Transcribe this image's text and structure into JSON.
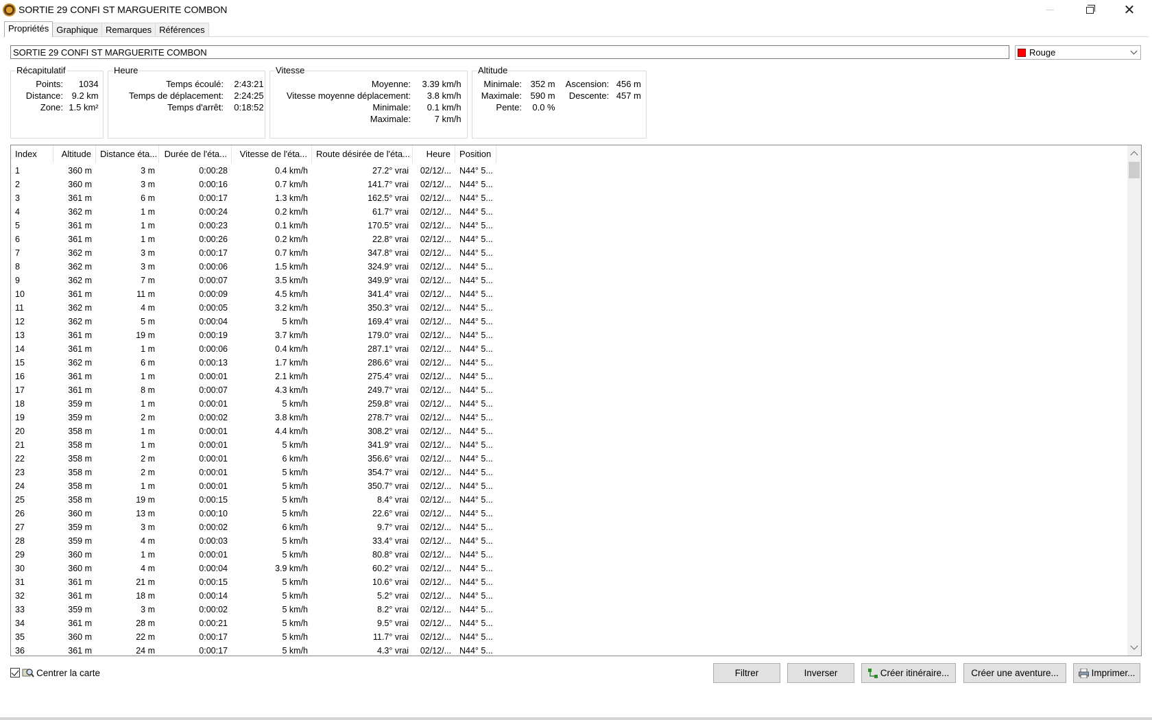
{
  "window": {
    "title": "SORTIE 29 CONFI ST MARGUERITE COMBON"
  },
  "tabs": [
    {
      "label": "Propriétés"
    },
    {
      "label": "Graphique"
    },
    {
      "label": "Remarques"
    },
    {
      "label": "Références"
    }
  ],
  "track": {
    "name": "SORTIE 29 CONFI ST MARGUERITE COMBON",
    "color_label": "Rouge",
    "color_hex": "#ff0000"
  },
  "summary": {
    "legend": "Récapitulatif",
    "points_label": "Points:",
    "points": "1034",
    "distance_label": "Distance:",
    "distance": "9.2 km",
    "zone_label": "Zone:",
    "zone": "1.5 km²"
  },
  "time": {
    "legend": "Heure",
    "elapsed_label": "Temps écoulé:",
    "elapsed": "2:43:21",
    "moving_label": "Temps de déplacement:",
    "moving": "2:24:25",
    "stopped_label": "Temps d'arrêt:",
    "stopped": "0:18:52"
  },
  "speed": {
    "legend": "Vitesse",
    "avg_label": "Moyenne:",
    "avg": "3.39 km/h",
    "moving_avg_label": "Vitesse moyenne déplacement:",
    "moving_avg": "3.8 km/h",
    "min_label": "Minimale:",
    "min": "0.1 km/h",
    "max_label": "Maximale:",
    "max": "7 km/h"
  },
  "altitude": {
    "legend": "Altitude",
    "min_label": "Minimale:",
    "min": "352 m",
    "ascent_label": "Ascension:",
    "ascent": "456 m",
    "max_label": "Maximale:",
    "max": "590 m",
    "descent_label": "Descente:",
    "descent": "457 m",
    "slope_label": "Pente:",
    "slope": "0.0 %"
  },
  "table": {
    "columns": [
      "Index",
      "Altitude",
      "Distance éta...",
      "Durée de l'éta...",
      "Vitesse de l'éta...",
      "Route désirée de l'éta...",
      "Heure",
      "Position"
    ],
    "rows": [
      [
        "1",
        "360 m",
        "3 m",
        "0:00:28",
        "0.4 km/h",
        "27.2° vrai",
        "02/12/...",
        "N44° 5..."
      ],
      [
        "2",
        "360 m",
        "3 m",
        "0:00:16",
        "0.7 km/h",
        "141.7° vrai",
        "02/12/...",
        "N44° 5..."
      ],
      [
        "3",
        "361 m",
        "6 m",
        "0:00:17",
        "1.3 km/h",
        "162.5° vrai",
        "02/12/...",
        "N44° 5..."
      ],
      [
        "4",
        "362 m",
        "1 m",
        "0:00:24",
        "0.2 km/h",
        "61.7° vrai",
        "02/12/...",
        "N44° 5..."
      ],
      [
        "5",
        "361 m",
        "1 m",
        "0:00:23",
        "0.1 km/h",
        "170.5° vrai",
        "02/12/...",
        "N44° 5..."
      ],
      [
        "6",
        "361 m",
        "1 m",
        "0:00:26",
        "0.2 km/h",
        "22.8° vrai",
        "02/12/...",
        "N44° 5..."
      ],
      [
        "7",
        "362 m",
        "3 m",
        "0:00:17",
        "0.7 km/h",
        "347.8° vrai",
        "02/12/...",
        "N44° 5..."
      ],
      [
        "8",
        "362 m",
        "3 m",
        "0:00:06",
        "1.5 km/h",
        "324.9° vrai",
        "02/12/...",
        "N44° 5..."
      ],
      [
        "9",
        "362 m",
        "7 m",
        "0:00:07",
        "3.5 km/h",
        "349.9° vrai",
        "02/12/...",
        "N44° 5..."
      ],
      [
        "10",
        "361 m",
        "11 m",
        "0:00:09",
        "4.5 km/h",
        "341.4° vrai",
        "02/12/...",
        "N44° 5..."
      ],
      [
        "11",
        "362 m",
        "4 m",
        "0:00:05",
        "3.2 km/h",
        "350.3° vrai",
        "02/12/...",
        "N44° 5..."
      ],
      [
        "12",
        "362 m",
        "5 m",
        "0:00:04",
        "5 km/h",
        "169.4° vrai",
        "02/12/...",
        "N44° 5..."
      ],
      [
        "13",
        "361 m",
        "19 m",
        "0:00:19",
        "3.7 km/h",
        "179.0° vrai",
        "02/12/...",
        "N44° 5..."
      ],
      [
        "14",
        "361 m",
        "1 m",
        "0:00:06",
        "0.4 km/h",
        "287.1° vrai",
        "02/12/...",
        "N44° 5..."
      ],
      [
        "15",
        "362 m",
        "6 m",
        "0:00:13",
        "1.7 km/h",
        "286.6° vrai",
        "02/12/...",
        "N44° 5..."
      ],
      [
        "16",
        "361 m",
        "1 m",
        "0:00:01",
        "2.1 km/h",
        "275.4° vrai",
        "02/12/...",
        "N44° 5..."
      ],
      [
        "17",
        "361 m",
        "8 m",
        "0:00:07",
        "4.3 km/h",
        "249.7° vrai",
        "02/12/...",
        "N44° 5..."
      ],
      [
        "18",
        "359 m",
        "1 m",
        "0:00:01",
        "5 km/h",
        "259.8° vrai",
        "02/12/...",
        "N44° 5..."
      ],
      [
        "19",
        "359 m",
        "2 m",
        "0:00:02",
        "3.8 km/h",
        "278.7° vrai",
        "02/12/...",
        "N44° 5..."
      ],
      [
        "20",
        "358 m",
        "1 m",
        "0:00:01",
        "4.4 km/h",
        "308.2° vrai",
        "02/12/...",
        "N44° 5..."
      ],
      [
        "21",
        "358 m",
        "1 m",
        "0:00:01",
        "5 km/h",
        "341.9° vrai",
        "02/12/...",
        "N44° 5..."
      ],
      [
        "22",
        "358 m",
        "2 m",
        "0:00:01",
        "6 km/h",
        "356.6° vrai",
        "02/12/...",
        "N44° 5..."
      ],
      [
        "23",
        "358 m",
        "2 m",
        "0:00:01",
        "5 km/h",
        "354.7° vrai",
        "02/12/...",
        "N44° 5..."
      ],
      [
        "24",
        "358 m",
        "1 m",
        "0:00:01",
        "5 km/h",
        "350.7° vrai",
        "02/12/...",
        "N44° 5..."
      ],
      [
        "25",
        "358 m",
        "19 m",
        "0:00:15",
        "5 km/h",
        "8.4° vrai",
        "02/12/...",
        "N44° 5..."
      ],
      [
        "26",
        "360 m",
        "13 m",
        "0:00:10",
        "5 km/h",
        "22.6° vrai",
        "02/12/...",
        "N44° 5..."
      ],
      [
        "27",
        "359 m",
        "3 m",
        "0:00:02",
        "6 km/h",
        "9.7° vrai",
        "02/12/...",
        "N44° 5..."
      ],
      [
        "28",
        "359 m",
        "4 m",
        "0:00:03",
        "5 km/h",
        "33.4° vrai",
        "02/12/...",
        "N44° 5..."
      ],
      [
        "29",
        "360 m",
        "1 m",
        "0:00:01",
        "5 km/h",
        "80.8° vrai",
        "02/12/...",
        "N44° 5..."
      ],
      [
        "30",
        "360 m",
        "4 m",
        "0:00:04",
        "3.9 km/h",
        "60.2° vrai",
        "02/12/...",
        "N44° 5..."
      ],
      [
        "31",
        "361 m",
        "21 m",
        "0:00:15",
        "5 km/h",
        "10.6° vrai",
        "02/12/...",
        "N44° 5..."
      ],
      [
        "32",
        "361 m",
        "18 m",
        "0:00:14",
        "5 km/h",
        "5.2° vrai",
        "02/12/...",
        "N44° 5..."
      ],
      [
        "33",
        "359 m",
        "3 m",
        "0:00:02",
        "5 km/h",
        "8.2° vrai",
        "02/12/...",
        "N44° 5..."
      ],
      [
        "34",
        "361 m",
        "28 m",
        "0:00:21",
        "5 km/h",
        "9.5° vrai",
        "02/12/...",
        "N44° 5..."
      ],
      [
        "35",
        "360 m",
        "22 m",
        "0:00:17",
        "5 km/h",
        "11.7° vrai",
        "02/12/...",
        "N44° 5..."
      ],
      [
        "36",
        "361 m",
        "24 m",
        "0:00:17",
        "5 km/h",
        "4.3° vrai",
        "02/12/...",
        "N44° 5..."
      ]
    ]
  },
  "footer": {
    "center_map_label": "Centrer la carte",
    "center_map_checked": true,
    "filter_label": "Filtrer",
    "reverse_label": "Inverser",
    "create_route_label": "Créer itinéraire...",
    "create_adventure_label": "Créer une aventure...",
    "print_label": "Imprimer..."
  }
}
